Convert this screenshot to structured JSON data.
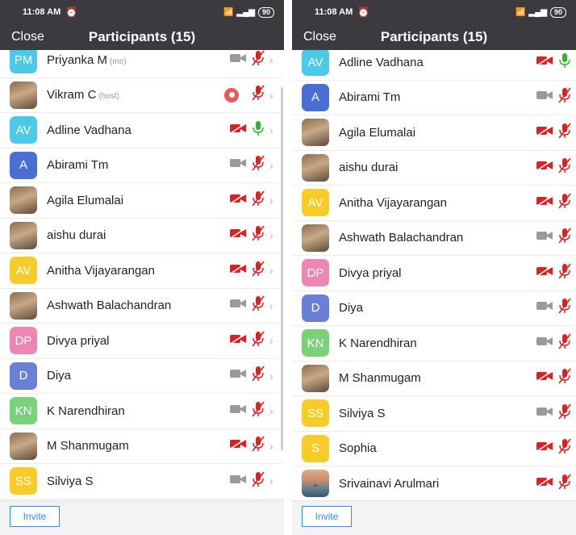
{
  "colors": {
    "header_bg": "#3a3a3f",
    "muted_red": "#e02020",
    "unmuted_green": "#2db52d",
    "video_off_gray": "#9a9a9a",
    "invite_blue": "#2d8cff",
    "avatar_cyan": "#4cc9e6",
    "avatar_blue": "#4a6fd3",
    "avatar_yellow": "#f8cc28",
    "avatar_pink": "#ee86b4",
    "avatar_indigo": "#6a7fd6",
    "avatar_green": "#7bd07a"
  },
  "left": {
    "status": {
      "time": "11:08 AM",
      "battery": "90"
    },
    "close_label": "Close",
    "title": "Participants (15)",
    "invite_label": "Invite",
    "participants": [
      {
        "initials": "PM",
        "name": "Priyanka M",
        "tag": "(me)",
        "color": "#4cc9e6",
        "photo": false,
        "video": "gray",
        "mic": "muted",
        "chevron": true
      },
      {
        "initials": "",
        "name": "Vikram C",
        "tag": "(host)",
        "color": "",
        "photo": true,
        "video": "none",
        "mic": "muted",
        "chevron": true,
        "recording": true
      },
      {
        "initials": "AV",
        "name": "Adline Vadhana",
        "tag": "",
        "color": "#4cc9e6",
        "photo": false,
        "video": "red",
        "mic": "on",
        "chevron": true
      },
      {
        "initials": "A",
        "name": "Abirami Tm",
        "tag": "",
        "color": "#4a6fd3",
        "photo": false,
        "video": "gray",
        "mic": "muted",
        "chevron": true
      },
      {
        "initials": "",
        "name": "Agila Elumalai",
        "tag": "",
        "color": "",
        "photo": true,
        "video": "red",
        "mic": "muted",
        "chevron": true
      },
      {
        "initials": "",
        "name": "aishu durai",
        "tag": "",
        "color": "",
        "photo": true,
        "video": "red",
        "mic": "muted",
        "chevron": true
      },
      {
        "initials": "AV",
        "name": "Anitha Vijayarangan",
        "tag": "",
        "color": "#f8cc28",
        "photo": false,
        "video": "red",
        "mic": "muted",
        "chevron": true
      },
      {
        "initials": "",
        "name": "Ashwath Balachandran",
        "tag": "",
        "color": "",
        "photo": true,
        "video": "gray",
        "mic": "muted",
        "chevron": true
      },
      {
        "initials": "DP",
        "name": "Divya priyal",
        "tag": "",
        "color": "#ee86b4",
        "photo": false,
        "video": "red",
        "mic": "muted",
        "chevron": true
      },
      {
        "initials": "D",
        "name": "Diya",
        "tag": "",
        "color": "#6a7fd6",
        "photo": false,
        "video": "gray",
        "mic": "muted",
        "chevron": true
      },
      {
        "initials": "KN",
        "name": "K Narendhiran",
        "tag": "",
        "color": "#7bd07a",
        "photo": false,
        "video": "gray",
        "mic": "muted",
        "chevron": true
      },
      {
        "initials": "",
        "name": "M Shanmugam",
        "tag": "",
        "color": "",
        "photo": true,
        "video": "red",
        "mic": "muted",
        "chevron": true
      },
      {
        "initials": "SS",
        "name": "Silviya S",
        "tag": "",
        "color": "#f8cc28",
        "photo": false,
        "video": "gray",
        "mic": "muted",
        "chevron": true
      }
    ]
  },
  "right": {
    "status": {
      "time": "11:08 AM",
      "battery": "90"
    },
    "close_label": "Close",
    "title": "Participants (15)",
    "invite_label": "Invite",
    "participants": [
      {
        "initials": "AV",
        "name": "Adline Vadhana",
        "tag": "",
        "color": "#4cc9e6",
        "photo": false,
        "video": "red",
        "mic": "on",
        "chevron": false
      },
      {
        "initials": "A",
        "name": "Abirami Tm",
        "tag": "",
        "color": "#4a6fd3",
        "photo": false,
        "video": "gray",
        "mic": "muted",
        "chevron": false
      },
      {
        "initials": "",
        "name": "Agila Elumalai",
        "tag": "",
        "color": "",
        "photo": true,
        "video": "red",
        "mic": "muted",
        "chevron": false
      },
      {
        "initials": "",
        "name": "aishu durai",
        "tag": "",
        "color": "",
        "photo": true,
        "video": "red",
        "mic": "muted",
        "chevron": false
      },
      {
        "initials": "AV",
        "name": "Anitha Vijayarangan",
        "tag": "",
        "color": "#f8cc28",
        "photo": false,
        "video": "red",
        "mic": "muted",
        "chevron": false
      },
      {
        "initials": "",
        "name": "Ashwath Balachandran",
        "tag": "",
        "color": "",
        "photo": true,
        "video": "gray",
        "mic": "muted",
        "chevron": false
      },
      {
        "initials": "DP",
        "name": "Divya priyal",
        "tag": "",
        "color": "#ee86b4",
        "photo": false,
        "video": "red",
        "mic": "muted",
        "chevron": false
      },
      {
        "initials": "D",
        "name": "Diya",
        "tag": "",
        "color": "#6a7fd6",
        "photo": false,
        "video": "gray",
        "mic": "muted",
        "chevron": false
      },
      {
        "initials": "KN",
        "name": "K Narendhiran",
        "tag": "",
        "color": "#7bd07a",
        "photo": false,
        "video": "gray",
        "mic": "muted",
        "chevron": false
      },
      {
        "initials": "",
        "name": "M Shanmugam",
        "tag": "",
        "color": "",
        "photo": true,
        "video": "red",
        "mic": "muted",
        "chevron": false
      },
      {
        "initials": "SS",
        "name": "Silviya S",
        "tag": "",
        "color": "#f8cc28",
        "photo": false,
        "video": "gray",
        "mic": "muted",
        "chevron": false
      },
      {
        "initials": "S",
        "name": "Sophia",
        "tag": "",
        "color": "#f8cc28",
        "photo": false,
        "video": "red",
        "mic": "muted",
        "chevron": false
      },
      {
        "initials": "",
        "name": "Srivainavi Arulmari",
        "tag": "",
        "color": "",
        "photo": true,
        "sky": true,
        "video": "red",
        "mic": "muted",
        "chevron": false
      }
    ]
  }
}
